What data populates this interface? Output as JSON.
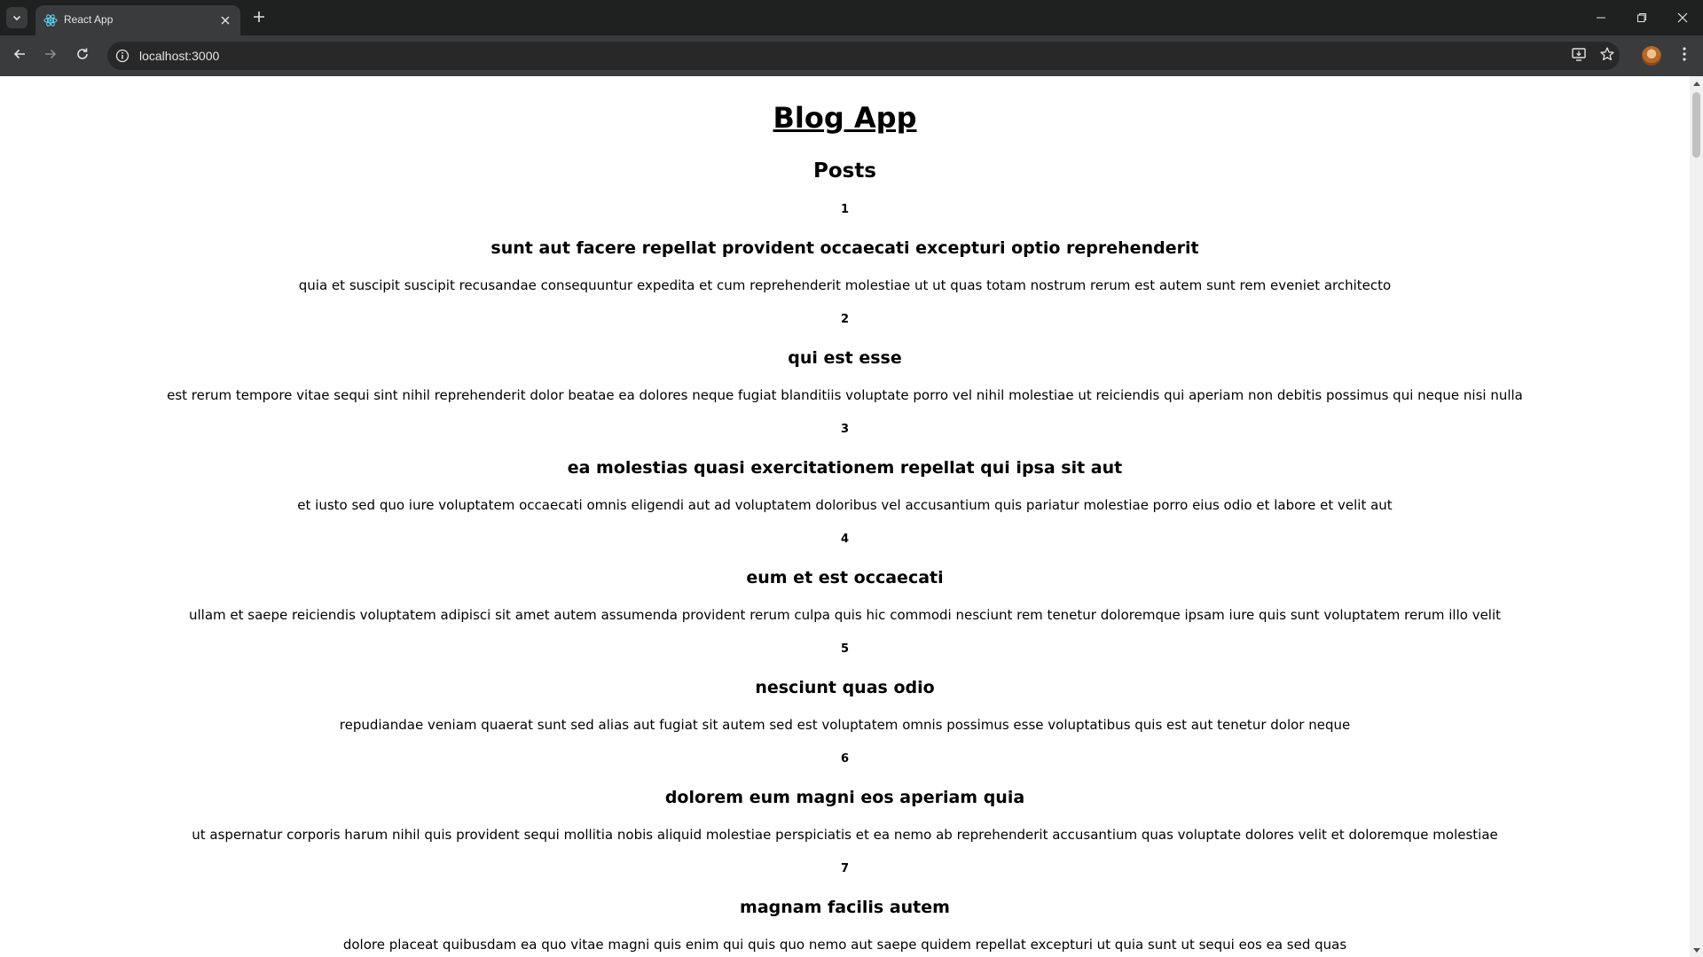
{
  "browser": {
    "tab_title": "React App",
    "url": "localhost:3000"
  },
  "page": {
    "app_title": "Blog App",
    "posts_heading": "Posts",
    "posts": [
      {
        "id": "1",
        "title": "sunt aut facere repellat provident occaecati excepturi optio reprehenderit",
        "body": "quia et suscipit suscipit recusandae consequuntur expedita et cum reprehenderit molestiae ut ut quas totam nostrum rerum est autem sunt rem eveniet architecto"
      },
      {
        "id": "2",
        "title": "qui est esse",
        "body": "est rerum tempore vitae sequi sint nihil reprehenderit dolor beatae ea dolores neque fugiat blanditiis voluptate porro vel nihil molestiae ut reiciendis qui aperiam non debitis possimus qui neque nisi nulla"
      },
      {
        "id": "3",
        "title": "ea molestias quasi exercitationem repellat qui ipsa sit aut",
        "body": "et iusto sed quo iure voluptatem occaecati omnis eligendi aut ad voluptatem doloribus vel accusantium quis pariatur molestiae porro eius odio et labore et velit aut"
      },
      {
        "id": "4",
        "title": "eum et est occaecati",
        "body": "ullam et saepe reiciendis voluptatem adipisci sit amet autem assumenda provident rerum culpa quis hic commodi nesciunt rem tenetur doloremque ipsam iure quis sunt voluptatem rerum illo velit"
      },
      {
        "id": "5",
        "title": "nesciunt quas odio",
        "body": "repudiandae veniam quaerat sunt sed alias aut fugiat sit autem sed est voluptatem omnis possimus esse voluptatibus quis est aut tenetur dolor neque"
      },
      {
        "id": "6",
        "title": "dolorem eum magni eos aperiam quia",
        "body": "ut aspernatur corporis harum nihil quis provident sequi mollitia nobis aliquid molestiae perspiciatis et ea nemo ab reprehenderit accusantium quas voluptate dolores velit et doloremque molestiae"
      },
      {
        "id": "7",
        "title": "magnam facilis autem",
        "body": "dolore placeat quibusdam ea quo vitae magni quis enim qui quis quo nemo aut saepe quidem repellat excepturi ut quia sunt ut sequi eos ea sed quas"
      }
    ]
  }
}
